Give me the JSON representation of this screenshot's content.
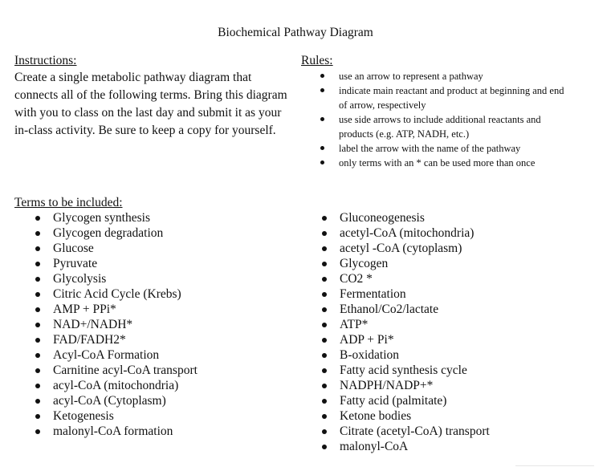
{
  "document": {
    "title": "Biochemical Pathway Diagram"
  },
  "instructions": {
    "heading": "Instructions:",
    "body": "Create a single metabolic pathway diagram that connects all of the following terms. Bring this diagram with you to class on the last day and submit it as your in-class activity. Be sure to keep a copy for yourself."
  },
  "rules": {
    "heading": "Rules:",
    "items": [
      "use an arrow to represent a pathway",
      "indicate main reactant and product at beginning and end of arrow, respectively",
      "use side arrows to include additional reactants and products (e.g. ATP, NADH, etc.)",
      "label the arrow with the name of the pathway",
      "only terms with an * can be used more than once"
    ]
  },
  "terms": {
    "heading": "Terms to be included:",
    "left": [
      "Glycogen synthesis",
      "Glycogen degradation",
      "Glucose",
      "Pyruvate",
      "Glycolysis",
      "Citric Acid Cycle (Krebs)",
      "AMP + PPi*",
      "NAD+/NADH*",
      "FAD/FADH2*",
      "Acyl-CoA Formation",
      "Carnitine acyl-CoA transport",
      "acyl-CoA (mitochondria)",
      "acyl-CoA (Cytoplasm)",
      "Ketogenesis",
      "malonyl-CoA formation"
    ],
    "right": [
      "Gluconeogenesis",
      "acetyl-CoA (mitochondria)",
      "acetyl -CoA (cytoplasm)",
      "Glycogen",
      "CO2 *",
      "Fermentation",
      "Ethanol/Co2/lactate",
      "ATP*",
      "ADP + Pi*",
      "B-oxidation",
      "Fatty acid synthesis cycle",
      "NADPH/NADP+*",
      "Fatty acid (palmitate)",
      "Ketone bodies",
      "Citrate (acetyl-CoA) transport",
      "malonyl-CoA"
    ]
  }
}
